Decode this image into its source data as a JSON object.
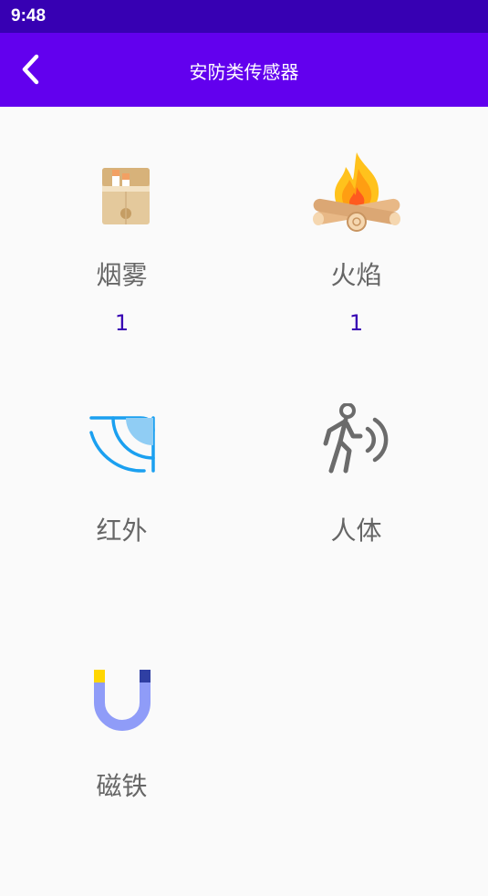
{
  "status_bar": {
    "time": "9:48"
  },
  "app_bar": {
    "title": "安防类传感器"
  },
  "colors": {
    "status_bar": "#3700b3",
    "app_bar": "#6200ee",
    "count_text": "#3700b3",
    "label_text": "#666666"
  },
  "sensors": [
    {
      "label": "烟雾",
      "count": "1",
      "icon": "cigarette-pack-icon"
    },
    {
      "label": "火焰",
      "count": "1",
      "icon": "campfire-icon"
    },
    {
      "label": "红外",
      "count": "",
      "icon": "infrared-signal-icon"
    },
    {
      "label": "人体",
      "count": "",
      "icon": "walking-person-icon"
    },
    {
      "label": "磁铁",
      "count": "",
      "icon": "magnet-icon"
    }
  ]
}
